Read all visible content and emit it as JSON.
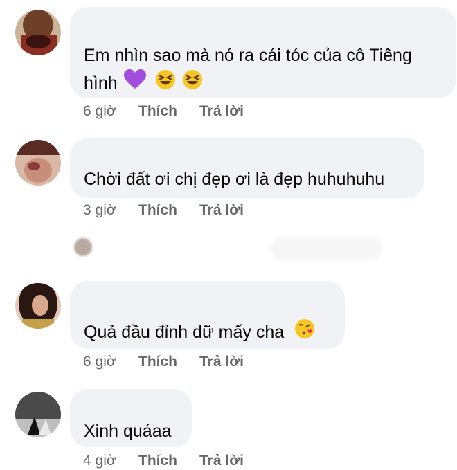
{
  "comments": [
    {
      "text_lines": [
        "Em nhìn sao mà nó ra cái tóc của cô Tiêng",
        "hình"
      ],
      "emojis": [
        "purple-heart",
        "grinning-squinting-face",
        "grinning-squinting-face"
      ],
      "time": "6 giờ",
      "like_label": "Thích",
      "reply_label": "Trả lời"
    },
    {
      "text_lines": [
        "Chời đất ơi chị đẹp ơi là đẹp huhuhuhu"
      ],
      "time": "3 giờ",
      "like_label": "Thích",
      "reply_label": "Trả lời"
    },
    {
      "text_lines": [
        "Quả đầu đỉnh dữ mấy cha"
      ],
      "emojis": [
        "face-blowing-a-kiss"
      ],
      "time": "6 giờ",
      "like_label": "Thích",
      "reply_label": "Trả lời"
    },
    {
      "text_lines": [
        "Xinh quáaa"
      ],
      "time": "4 giờ",
      "like_label": "Thích",
      "reply_label": "Trả lời"
    }
  ],
  "colors": {
    "bubble": "#f0f2f5",
    "text": "#050505",
    "meta": "#65676b",
    "heart": "#a24ce0",
    "emoji_face": "#f7c623"
  }
}
